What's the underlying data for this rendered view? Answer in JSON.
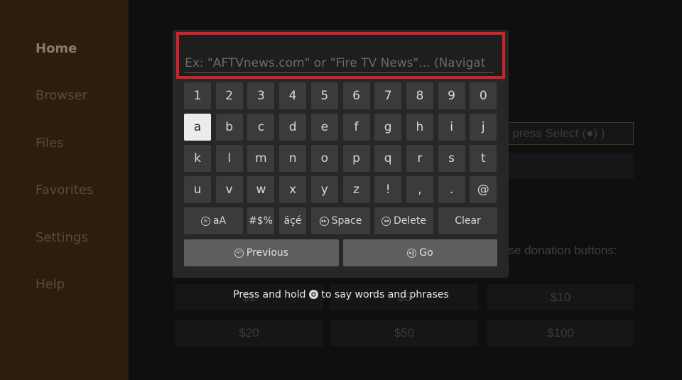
{
  "sidebar": {
    "items": [
      {
        "label": "Home",
        "active": true
      },
      {
        "label": "Browser"
      },
      {
        "label": "Files"
      },
      {
        "label": "Favorites"
      },
      {
        "label": "Settings"
      },
      {
        "label": "Help"
      }
    ]
  },
  "background": {
    "select_hint": "u press Select (●) )",
    "donation_text": "ase donation buttons:",
    "donation_text2": ")",
    "donations": [
      "$1",
      "$5",
      "$10",
      "$20",
      "$50",
      "$100"
    ]
  },
  "search": {
    "placeholder": "Ex: \"AFTVnews.com\" or \"Fire TV News\"... (Navigat",
    "value": "",
    "highlight_color": "#d0222c"
  },
  "keyboard": {
    "rows": [
      [
        "1",
        "2",
        "3",
        "4",
        "5",
        "6",
        "7",
        "8",
        "9",
        "0"
      ],
      [
        "a",
        "b",
        "c",
        "d",
        "e",
        "f",
        "g",
        "h",
        "i",
        "j"
      ],
      [
        "k",
        "l",
        "m",
        "n",
        "o",
        "p",
        "q",
        "r",
        "s",
        "t"
      ],
      [
        "u",
        "v",
        "w",
        "x",
        "y",
        "z",
        "!",
        ",",
        ".",
        "@"
      ]
    ],
    "focused_key": "a",
    "case_label": "aA",
    "symbols_label": "#$%",
    "accents_label": "äçé",
    "space_label": "Space",
    "delete_label": "Delete",
    "clear_label": "Clear",
    "previous_label": "Previous",
    "go_label": "Go"
  },
  "hint": {
    "before": "Press and hold",
    "after": "to say words and phrases"
  }
}
